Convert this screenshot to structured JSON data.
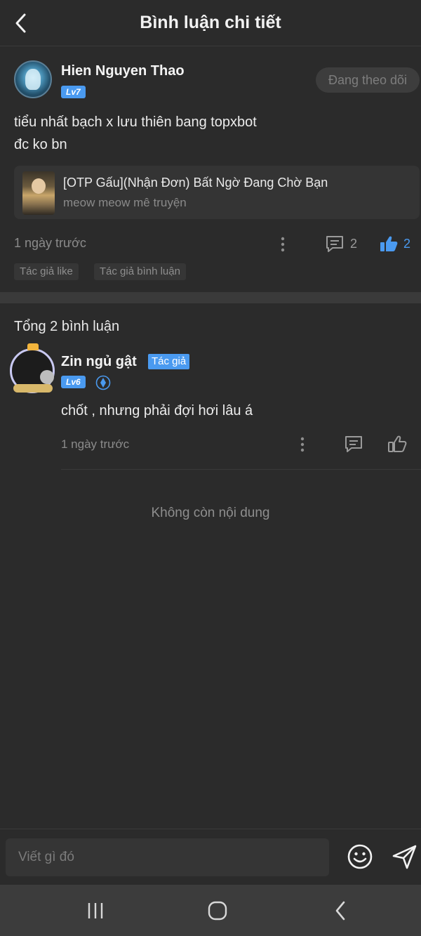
{
  "header": {
    "title": "Bình luận chi tiết"
  },
  "post": {
    "username": "Hien Nguyen Thao",
    "level": "Lv7",
    "follow_label": "Đang theo dõi",
    "text_line1": "tiểu nhất bạch x lưu thiên bang topxbot",
    "text_line2": "đc ko bn",
    "story": {
      "title": "[OTP Gấu](Nhận Đơn) Bất Ngờ Đang Chờ Bạn",
      "author": "meow meow mê truyện"
    },
    "time": "1 ngày trước",
    "comment_count": "2",
    "like_count": "2",
    "tags": [
      "Tác giả like",
      "Tác giả bình luận"
    ]
  },
  "comments_section": {
    "total_label": "Tổng 2 bình luận"
  },
  "reply": {
    "username": "Zin ngủ gật",
    "author_badge": "Tác giả",
    "level": "Lv6",
    "text": "chốt , nhưng phải đợi hơi lâu á",
    "time": "1 ngày trước"
  },
  "end_label": "Không còn nội dung",
  "input": {
    "placeholder": "Viết gì đó"
  },
  "colors": {
    "accent": "#4a9af0",
    "background": "#2b2b2b",
    "divider": "#3a3a3a"
  },
  "icons": {
    "back": "chevron-left-icon",
    "more": "more-vertical-icon",
    "comment": "comment-icon",
    "like": "thumb-up-icon",
    "verify": "verified-icon",
    "emoji": "emoji-icon",
    "send": "send-icon"
  }
}
